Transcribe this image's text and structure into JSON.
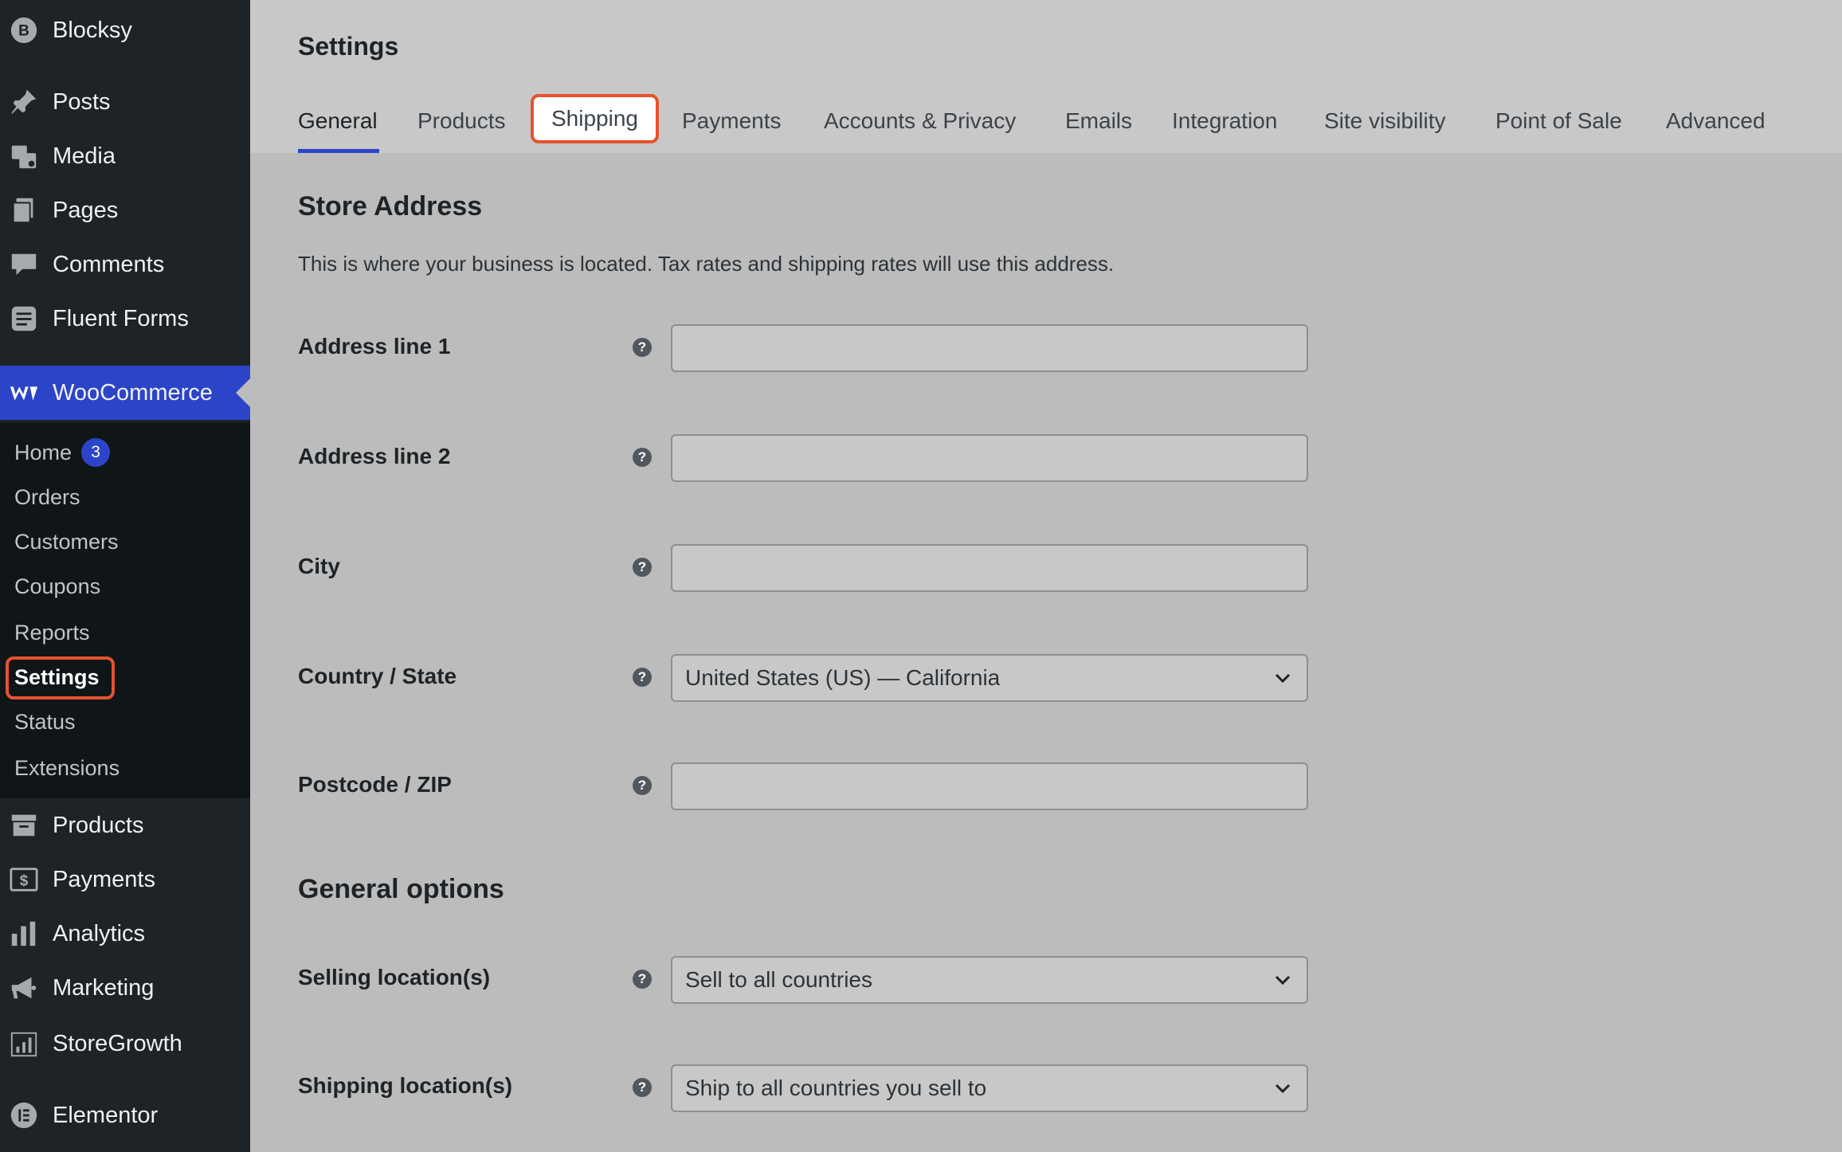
{
  "sidebar": {
    "top_items": [
      {
        "label": "Blocksy",
        "icon": "blocksy-icon"
      },
      {
        "label": "Posts",
        "icon": "pin-icon"
      },
      {
        "label": "Media",
        "icon": "media-icon"
      },
      {
        "label": "Pages",
        "icon": "pages-icon"
      },
      {
        "label": "Comments",
        "icon": "comment-icon"
      },
      {
        "label": "Fluent Forms",
        "icon": "forms-icon"
      }
    ],
    "current": {
      "label": "WooCommerce",
      "icon": "woo-icon"
    },
    "submenu": [
      {
        "label": "Home",
        "badge": "3"
      },
      {
        "label": "Orders"
      },
      {
        "label": "Customers"
      },
      {
        "label": "Coupons"
      },
      {
        "label": "Reports"
      },
      {
        "label": "Settings"
      },
      {
        "label": "Status"
      },
      {
        "label": "Extensions"
      }
    ],
    "bottom_items": [
      {
        "label": "Products",
        "icon": "archive-icon"
      },
      {
        "label": "Payments",
        "icon": "dollar-icon"
      },
      {
        "label": "Analytics",
        "icon": "bar-chart-icon"
      },
      {
        "label": "Marketing",
        "icon": "megaphone-icon"
      },
      {
        "label": "StoreGrowth",
        "icon": "growth-icon"
      },
      {
        "label": "Elementor",
        "icon": "elementor-icon"
      }
    ]
  },
  "header": {
    "title": "Settings",
    "tabs": [
      "General",
      "Products",
      "Shipping",
      "Payments",
      "Accounts & Privacy",
      "Emails",
      "Integration",
      "Site visibility",
      "Point of Sale",
      "Advanced"
    ],
    "active_tab": "General"
  },
  "store_address": {
    "title": "Store Address",
    "description": "This is where your business is located. Tax rates and shipping rates will use this address.",
    "fields": {
      "address1": {
        "label": "Address line 1",
        "value": ""
      },
      "address2": {
        "label": "Address line 2",
        "value": ""
      },
      "city": {
        "label": "City",
        "value": ""
      },
      "country": {
        "label": "Country / State",
        "value": "United States (US) — California"
      },
      "postcode": {
        "label": "Postcode / ZIP",
        "value": ""
      }
    }
  },
  "general_options": {
    "title": "General options",
    "selling": {
      "label": "Selling location(s)",
      "value": "Sell to all countries"
    },
    "shipping": {
      "label": "Shipping location(s)",
      "value": "Ship to all countries you sell to"
    }
  },
  "help_glyph": "?",
  "colors": {
    "accent": "#2c45c8",
    "highlight": "#e4532f",
    "sidebar": "#1d2327"
  }
}
